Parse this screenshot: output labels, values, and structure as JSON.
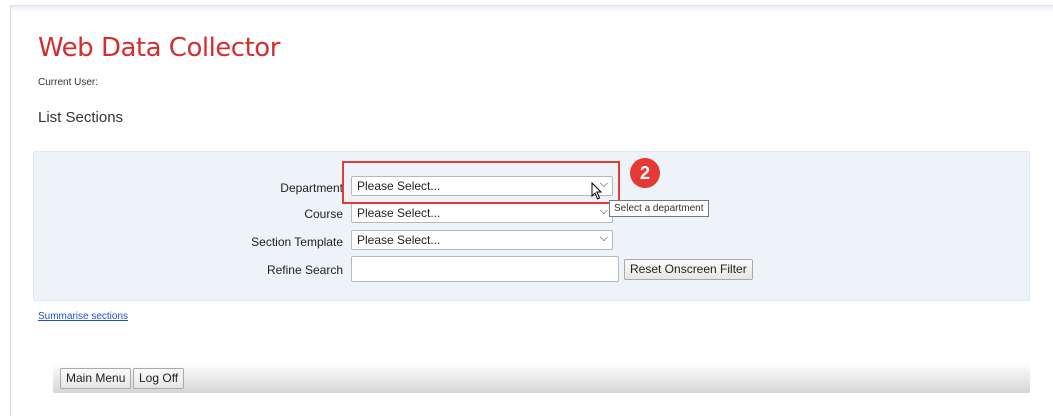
{
  "app": {
    "title": "Web Data Collector",
    "current_user_label": "Current User:",
    "page_heading": "List Sections"
  },
  "filters": {
    "department": {
      "label": "Department",
      "value": "Please Select..."
    },
    "course": {
      "label": "Course",
      "value": "Please Select..."
    },
    "section_template": {
      "label": "Section Template",
      "value": "Please Select..."
    },
    "refine_search": {
      "label": "Refine Search",
      "value": ""
    },
    "reset_button_label": "Reset Onscreen Filter"
  },
  "annotation": {
    "step_number": "2",
    "tooltip": "Select a department",
    "highlight_color": "#e53935"
  },
  "links": {
    "summarise_sections": "Summarise sections"
  },
  "footer": {
    "main_menu_label": "Main Menu",
    "log_off_label": "Log Off"
  },
  "colors": {
    "title": "#d32f2f",
    "panel_background": "#eef3fa",
    "link": "#1a4fd6"
  }
}
